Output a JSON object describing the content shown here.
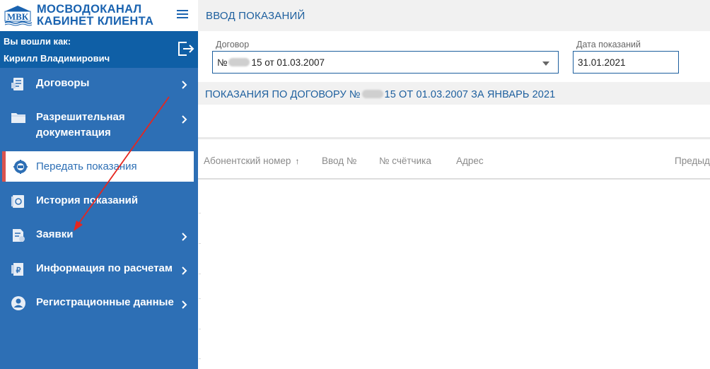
{
  "brand": {
    "logo_text": "МВК",
    "name_line1": "МОСВОДОКАНАЛ",
    "name_line2": "КАБИНЕТ КЛИЕНТА"
  },
  "user": {
    "label": "Вы вошли как:",
    "name": "Кирилл Владимирович"
  },
  "sidebar": {
    "items": [
      {
        "label": "Договоры",
        "icon": "contracts-icon",
        "has_submenu": true
      },
      {
        "label": "Разрешительная",
        "label2": "документация",
        "icon": "folder-icon",
        "has_submenu": true
      },
      {
        "label": "Передать показания",
        "icon": "meter-icon",
        "active": true
      },
      {
        "label": "История показаний",
        "icon": "history-icon"
      },
      {
        "label": "Заявки",
        "icon": "requests-icon",
        "has_submenu": true
      },
      {
        "label": "Информация по расчетам",
        "icon": "billing-icon",
        "has_submenu": true
      },
      {
        "label": "Регистрационные данные",
        "icon": "user-icon",
        "has_submenu": true
      }
    ]
  },
  "header": {
    "title": "ВВОД ПОКАЗАНИЙ"
  },
  "form": {
    "contract_label": "Договор",
    "contract_prefix": "№",
    "contract_suffix": "15 от 01.03.2007",
    "date_label": "Дата показаний",
    "date_value": "31.01.2021"
  },
  "section": {
    "title_prefix": "ПОКАЗАНИЯ ПО ДОГОВОРУ №",
    "title_suffix": "15 ОТ 01.03.2007 ЗА ЯНВАРЬ 2021"
  },
  "table": {
    "columns": [
      "Абонентский номер",
      "Ввод №",
      "№ счётчика",
      "Адрес",
      "Предыд"
    ],
    "sort_indicator": "↑"
  },
  "colors": {
    "sidebar": "#2d6fb5",
    "user_box": "#0f5fa6",
    "accent_text": "#1d5f9e",
    "active_marker": "#d9534f",
    "annotation_arrow": "#e5261f"
  }
}
